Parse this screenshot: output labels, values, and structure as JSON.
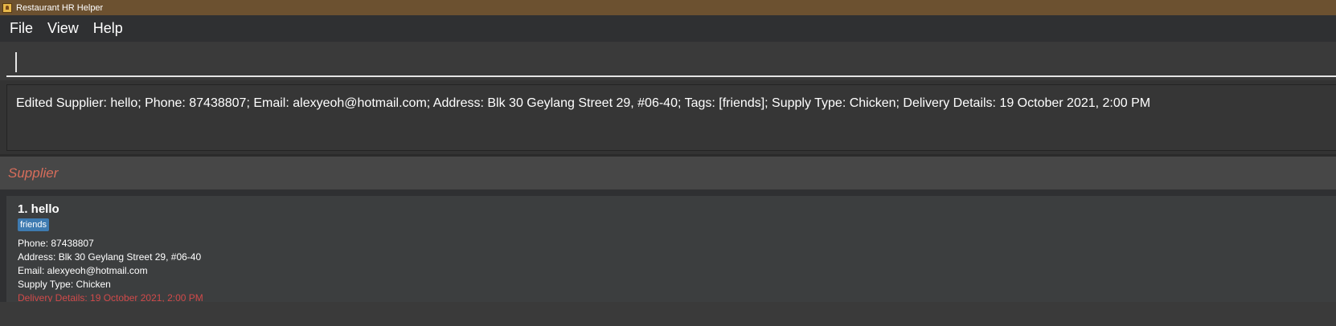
{
  "window": {
    "title": "Restaurant HR Helper",
    "icon": "restaurant-app-icon"
  },
  "menu": {
    "items": [
      "File",
      "View",
      "Help"
    ]
  },
  "command": {
    "value": ""
  },
  "result": {
    "text": "Edited Supplier: hello; Phone: 87438807; Email: alexyeoh@hotmail.com; Address: Blk 30 Geylang Street 29, #06-40; Tags: [friends]; Supply Type: Chicken; Delivery Details: 19 October 2021, 2:00 PM"
  },
  "list": {
    "title": "Supplier",
    "cards": [
      {
        "index_name": "1.  hello",
        "tags": [
          "friends"
        ],
        "phone": "Phone: 87438807",
        "address": "Address: Blk 30 Geylang Street 29, #06-40",
        "email": "Email: alexyeoh@hotmail.com",
        "supply_type": "Supply Type: Chicken",
        "delivery": "Delivery Details: 19 October 2021, 2:00 PM"
      }
    ]
  },
  "colors": {
    "titlebar": "#6c5130",
    "list_title": "#d76d5b",
    "tag": "#3e7bb1",
    "delivery": "#d04a4a"
  }
}
